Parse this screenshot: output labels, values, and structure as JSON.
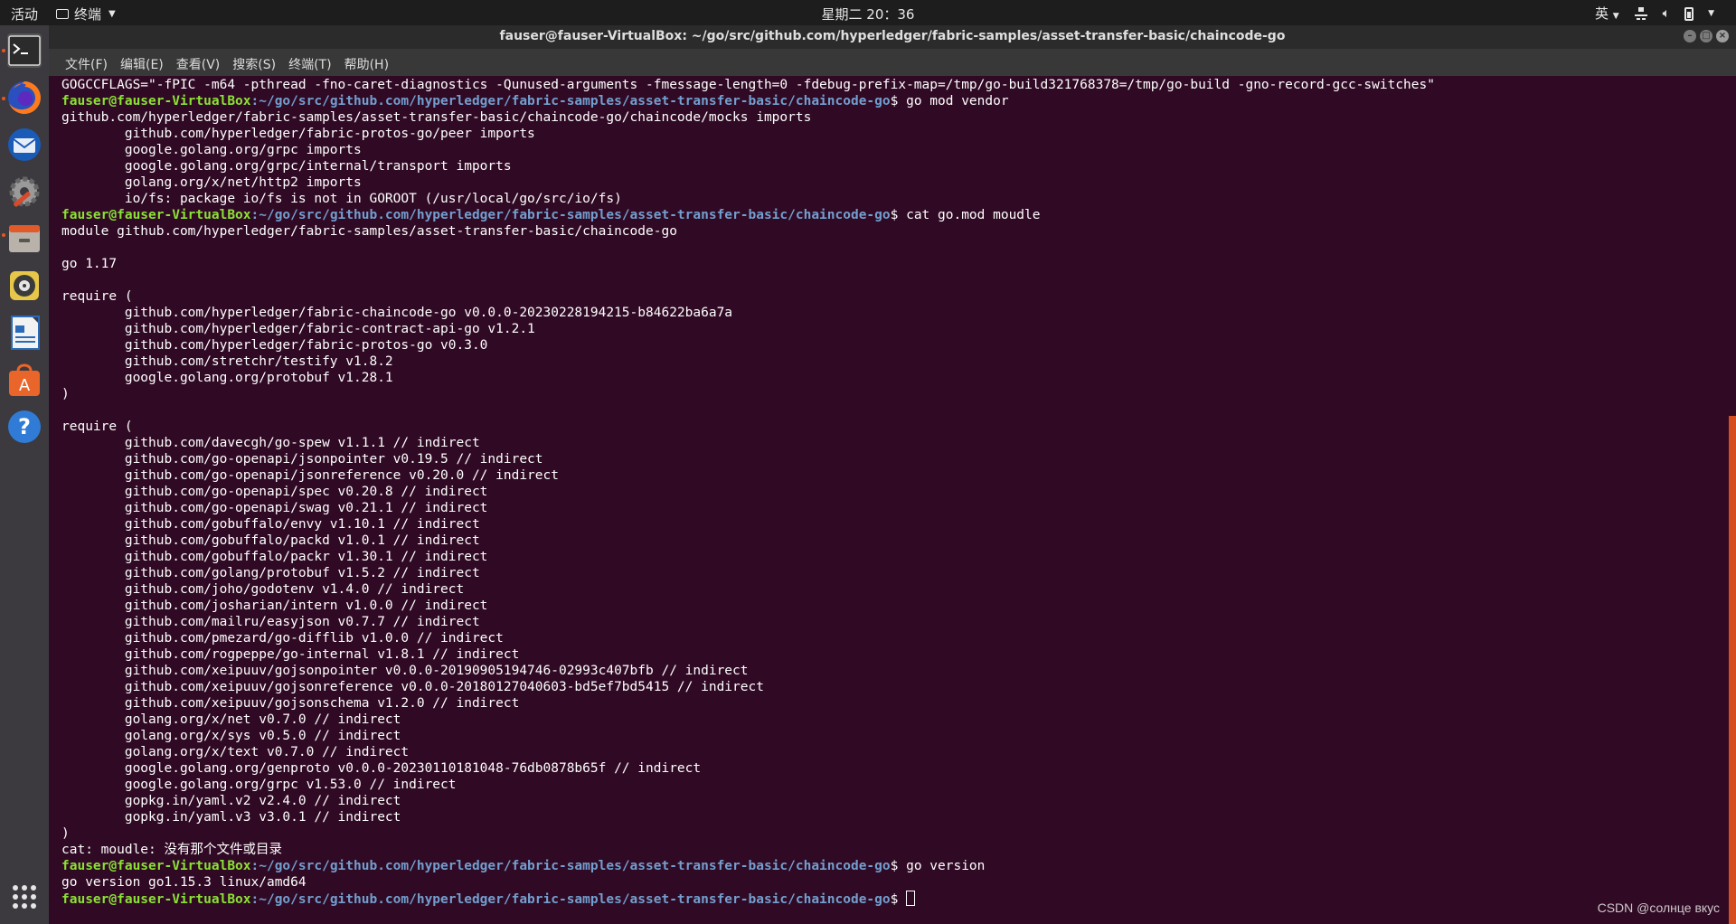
{
  "topbar": {
    "activities": "活动",
    "app_menu": "终端",
    "clock": "星期二 20：36",
    "input_method": "英"
  },
  "window": {
    "title": "fauser@fauser-VirtualBox: ~/go/src/github.com/hyperledger/fabric-samples/asset-transfer-basic/chaincode-go"
  },
  "menubar": {
    "items": [
      "文件(F)",
      "编辑(E)",
      "查看(V)",
      "搜索(S)",
      "终端(T)",
      "帮助(H)"
    ]
  },
  "dock": {
    "items": [
      "terminal-icon",
      "firefox-icon",
      "thunderbird-icon",
      "settings-icon",
      "files-icon",
      "rhythmbox-icon",
      "writer-icon",
      "software-icon",
      "help-icon",
      "show-apps-icon"
    ]
  },
  "terminal": {
    "prompt_user": "fauser@fauser-VirtualBox",
    "prompt_path": ":~/go/src/github.com/hyperledger/fabric-samples/asset-transfer-basic/chaincode-go",
    "prompt_suffix": "$ ",
    "lines": [
      {
        "type": "out",
        "text": "GOGCCFLAGS=\"-fPIC -m64 -pthread -fno-caret-diagnostics -Qunused-arguments -fmessage-length=0 -fdebug-prefix-map=/tmp/go-build321768378=/tmp/go-build -gno-record-gcc-switches\""
      },
      {
        "type": "prompt",
        "cmd": "go mod vendor"
      },
      {
        "type": "out",
        "text": "github.com/hyperledger/fabric-samples/asset-transfer-basic/chaincode-go/chaincode/mocks imports"
      },
      {
        "type": "out",
        "text": "        github.com/hyperledger/fabric-protos-go/peer imports"
      },
      {
        "type": "out",
        "text": "        google.golang.org/grpc imports"
      },
      {
        "type": "out",
        "text": "        google.golang.org/grpc/internal/transport imports"
      },
      {
        "type": "out",
        "text": "        golang.org/x/net/http2 imports"
      },
      {
        "type": "out",
        "text": "        io/fs: package io/fs is not in GOROOT (/usr/local/go/src/io/fs)"
      },
      {
        "type": "prompt",
        "cmd": "cat go.mod moudle"
      },
      {
        "type": "out",
        "text": "module github.com/hyperledger/fabric-samples/asset-transfer-basic/chaincode-go"
      },
      {
        "type": "out",
        "text": ""
      },
      {
        "type": "out",
        "text": "go 1.17"
      },
      {
        "type": "out",
        "text": ""
      },
      {
        "type": "out",
        "text": "require ("
      },
      {
        "type": "out",
        "text": "        github.com/hyperledger/fabric-chaincode-go v0.0.0-20230228194215-b84622ba6a7a"
      },
      {
        "type": "out",
        "text": "        github.com/hyperledger/fabric-contract-api-go v1.2.1"
      },
      {
        "type": "out",
        "text": "        github.com/hyperledger/fabric-protos-go v0.3.0"
      },
      {
        "type": "out",
        "text": "        github.com/stretchr/testify v1.8.2"
      },
      {
        "type": "out",
        "text": "        google.golang.org/protobuf v1.28.1"
      },
      {
        "type": "out",
        "text": ")"
      },
      {
        "type": "out",
        "text": ""
      },
      {
        "type": "out",
        "text": "require ("
      },
      {
        "type": "out",
        "text": "        github.com/davecgh/go-spew v1.1.1 // indirect"
      },
      {
        "type": "out",
        "text": "        github.com/go-openapi/jsonpointer v0.19.5 // indirect"
      },
      {
        "type": "out",
        "text": "        github.com/go-openapi/jsonreference v0.20.0 // indirect"
      },
      {
        "type": "out",
        "text": "        github.com/go-openapi/spec v0.20.8 // indirect"
      },
      {
        "type": "out",
        "text": "        github.com/go-openapi/swag v0.21.1 // indirect"
      },
      {
        "type": "out",
        "text": "        github.com/gobuffalo/envy v1.10.1 // indirect"
      },
      {
        "type": "out",
        "text": "        github.com/gobuffalo/packd v1.0.1 // indirect"
      },
      {
        "type": "out",
        "text": "        github.com/gobuffalo/packr v1.30.1 // indirect"
      },
      {
        "type": "out",
        "text": "        github.com/golang/protobuf v1.5.2 // indirect"
      },
      {
        "type": "out",
        "text": "        github.com/joho/godotenv v1.4.0 // indirect"
      },
      {
        "type": "out",
        "text": "        github.com/josharian/intern v1.0.0 // indirect"
      },
      {
        "type": "out",
        "text": "        github.com/mailru/easyjson v0.7.7 // indirect"
      },
      {
        "type": "out",
        "text": "        github.com/pmezard/go-difflib v1.0.0 // indirect"
      },
      {
        "type": "out",
        "text": "        github.com/rogpeppe/go-internal v1.8.1 // indirect"
      },
      {
        "type": "out",
        "text": "        github.com/xeipuuv/gojsonpointer v0.0.0-20190905194746-02993c407bfb // indirect"
      },
      {
        "type": "out",
        "text": "        github.com/xeipuuv/gojsonreference v0.0.0-20180127040603-bd5ef7bd5415 // indirect"
      },
      {
        "type": "out",
        "text": "        github.com/xeipuuv/gojsonschema v1.2.0 // indirect"
      },
      {
        "type": "out",
        "text": "        golang.org/x/net v0.7.0 // indirect"
      },
      {
        "type": "out",
        "text": "        golang.org/x/sys v0.5.0 // indirect"
      },
      {
        "type": "out",
        "text": "        golang.org/x/text v0.7.0 // indirect"
      },
      {
        "type": "out",
        "text": "        google.golang.org/genproto v0.0.0-20230110181048-76db0878b65f // indirect"
      },
      {
        "type": "out",
        "text": "        google.golang.org/grpc v1.53.0 // indirect"
      },
      {
        "type": "out",
        "text": "        gopkg.in/yaml.v2 v2.4.0 // indirect"
      },
      {
        "type": "out",
        "text": "        gopkg.in/yaml.v3 v3.0.1 // indirect"
      },
      {
        "type": "out",
        "text": ")"
      },
      {
        "type": "out",
        "text": "cat: moudle: 没有那个文件或目录"
      },
      {
        "type": "prompt",
        "cmd": "go version"
      },
      {
        "type": "out",
        "text": "go version go1.15.3 linux/amd64"
      },
      {
        "type": "prompt",
        "cmd": "",
        "cursor": true
      }
    ]
  },
  "watermark": "CSDN @солнце вкус",
  "colors": {
    "background": "#300a24",
    "prompt_user": "#8ae234",
    "prompt_path": "#729fcf",
    "accent": "#e95420"
  }
}
